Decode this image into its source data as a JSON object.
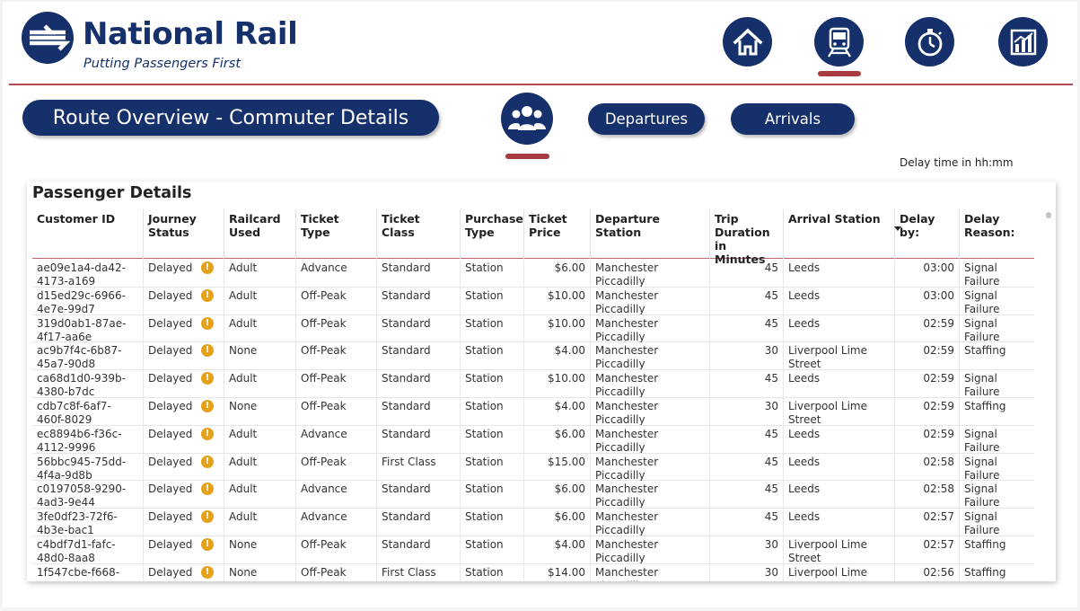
{
  "brand": {
    "name": "National Rail",
    "tagline": "Putting Passengers First"
  },
  "nav": [
    {
      "icon": "home-icon",
      "active": false
    },
    {
      "icon": "train-icon",
      "active": true
    },
    {
      "icon": "stopwatch-icon",
      "active": false
    },
    {
      "icon": "bar-chart-icon",
      "active": false
    }
  ],
  "page": {
    "title": "Route Overview - Commuter Details",
    "departures_label": "Departures",
    "arrivals_label": "Arrivals",
    "delay_note": "Delay time in hh:mm"
  },
  "colors": {
    "navy": "#16306b",
    "accent_red": "#a83a40",
    "warning": "#e3a21a"
  },
  "table": {
    "title": "Passenger Details",
    "sorted_column": "Delay by:",
    "columns": [
      "Customer ID",
      "Journey Status",
      "Railcard Used",
      "Ticket Type",
      "Ticket Class",
      "Purchase Type",
      "Ticket Price",
      "Departure Station",
      "Trip Duration in Minutes",
      "Arrival Station",
      "Delay by:",
      "Delay Reason:"
    ],
    "rows": [
      [
        "ae09e1a4-da42-4173-a169",
        "Delayed",
        "Adult",
        "Advance",
        "Standard",
        "Station",
        "$6.00",
        "Manchester Piccadilly",
        "45",
        "Leeds",
        "03:00",
        "Signal Failure"
      ],
      [
        "d15ed29c-6966-4e7e-99d7",
        "Delayed",
        "Adult",
        "Off-Peak",
        "Standard",
        "Station",
        "$10.00",
        "Manchester Piccadilly",
        "45",
        "Leeds",
        "03:00",
        "Signal Failure"
      ],
      [
        "319d0ab1-87ae-4f17-aa6e",
        "Delayed",
        "Adult",
        "Off-Peak",
        "Standard",
        "Station",
        "$10.00",
        "Manchester Piccadilly",
        "45",
        "Leeds",
        "02:59",
        "Signal Failure"
      ],
      [
        "ac9b7f4c-6b87-45a7-90d8",
        "Delayed",
        "None",
        "Off-Peak",
        "Standard",
        "Station",
        "$4.00",
        "Manchester Piccadilly",
        "30",
        "Liverpool Lime Street",
        "02:59",
        "Staffing"
      ],
      [
        "ca68d1d0-939b-4380-b7dc",
        "Delayed",
        "Adult",
        "Off-Peak",
        "Standard",
        "Station",
        "$10.00",
        "Manchester Piccadilly",
        "45",
        "Leeds",
        "02:59",
        "Signal Failure"
      ],
      [
        "cdb7c8f-6af7-460f-8029",
        "Delayed",
        "None",
        "Off-Peak",
        "Standard",
        "Station",
        "$4.00",
        "Manchester Piccadilly",
        "30",
        "Liverpool Lime Street",
        "02:59",
        "Staffing"
      ],
      [
        "ec8894b6-f36c-4112-9996",
        "Delayed",
        "Adult",
        "Advance",
        "Standard",
        "Station",
        "$6.00",
        "Manchester Piccadilly",
        "45",
        "Leeds",
        "02:59",
        "Signal Failure"
      ],
      [
        "56bbc945-75dd-4f4a-9d8b",
        "Delayed",
        "Adult",
        "Off-Peak",
        "First Class",
        "Station",
        "$15.00",
        "Manchester Piccadilly",
        "45",
        "Leeds",
        "02:58",
        "Signal Failure"
      ],
      [
        "c0197058-9290-4ad3-9e44",
        "Delayed",
        "Adult",
        "Advance",
        "Standard",
        "Station",
        "$6.00",
        "Manchester Piccadilly",
        "45",
        "Leeds",
        "02:58",
        "Signal Failure"
      ],
      [
        "3fe0df23-72f6-4b3e-bac1",
        "Delayed",
        "Adult",
        "Advance",
        "Standard",
        "Station",
        "$6.00",
        "Manchester Piccadilly",
        "45",
        "Leeds",
        "02:57",
        "Signal Failure"
      ],
      [
        "c4bdf7d1-fafc-48d0-8aa8",
        "Delayed",
        "None",
        "Off-Peak",
        "Standard",
        "Station",
        "$4.00",
        "Manchester Piccadilly",
        "30",
        "Liverpool Lime Street",
        "02:57",
        "Staffing"
      ],
      [
        "1f547cbe-f668-",
        "Delayed",
        "None",
        "Off-Peak",
        "First Class",
        "Station",
        "$14.00",
        "Manchester Piccadilly",
        "30",
        "Liverpool Lime",
        "02:56",
        "Staffing"
      ]
    ]
  }
}
